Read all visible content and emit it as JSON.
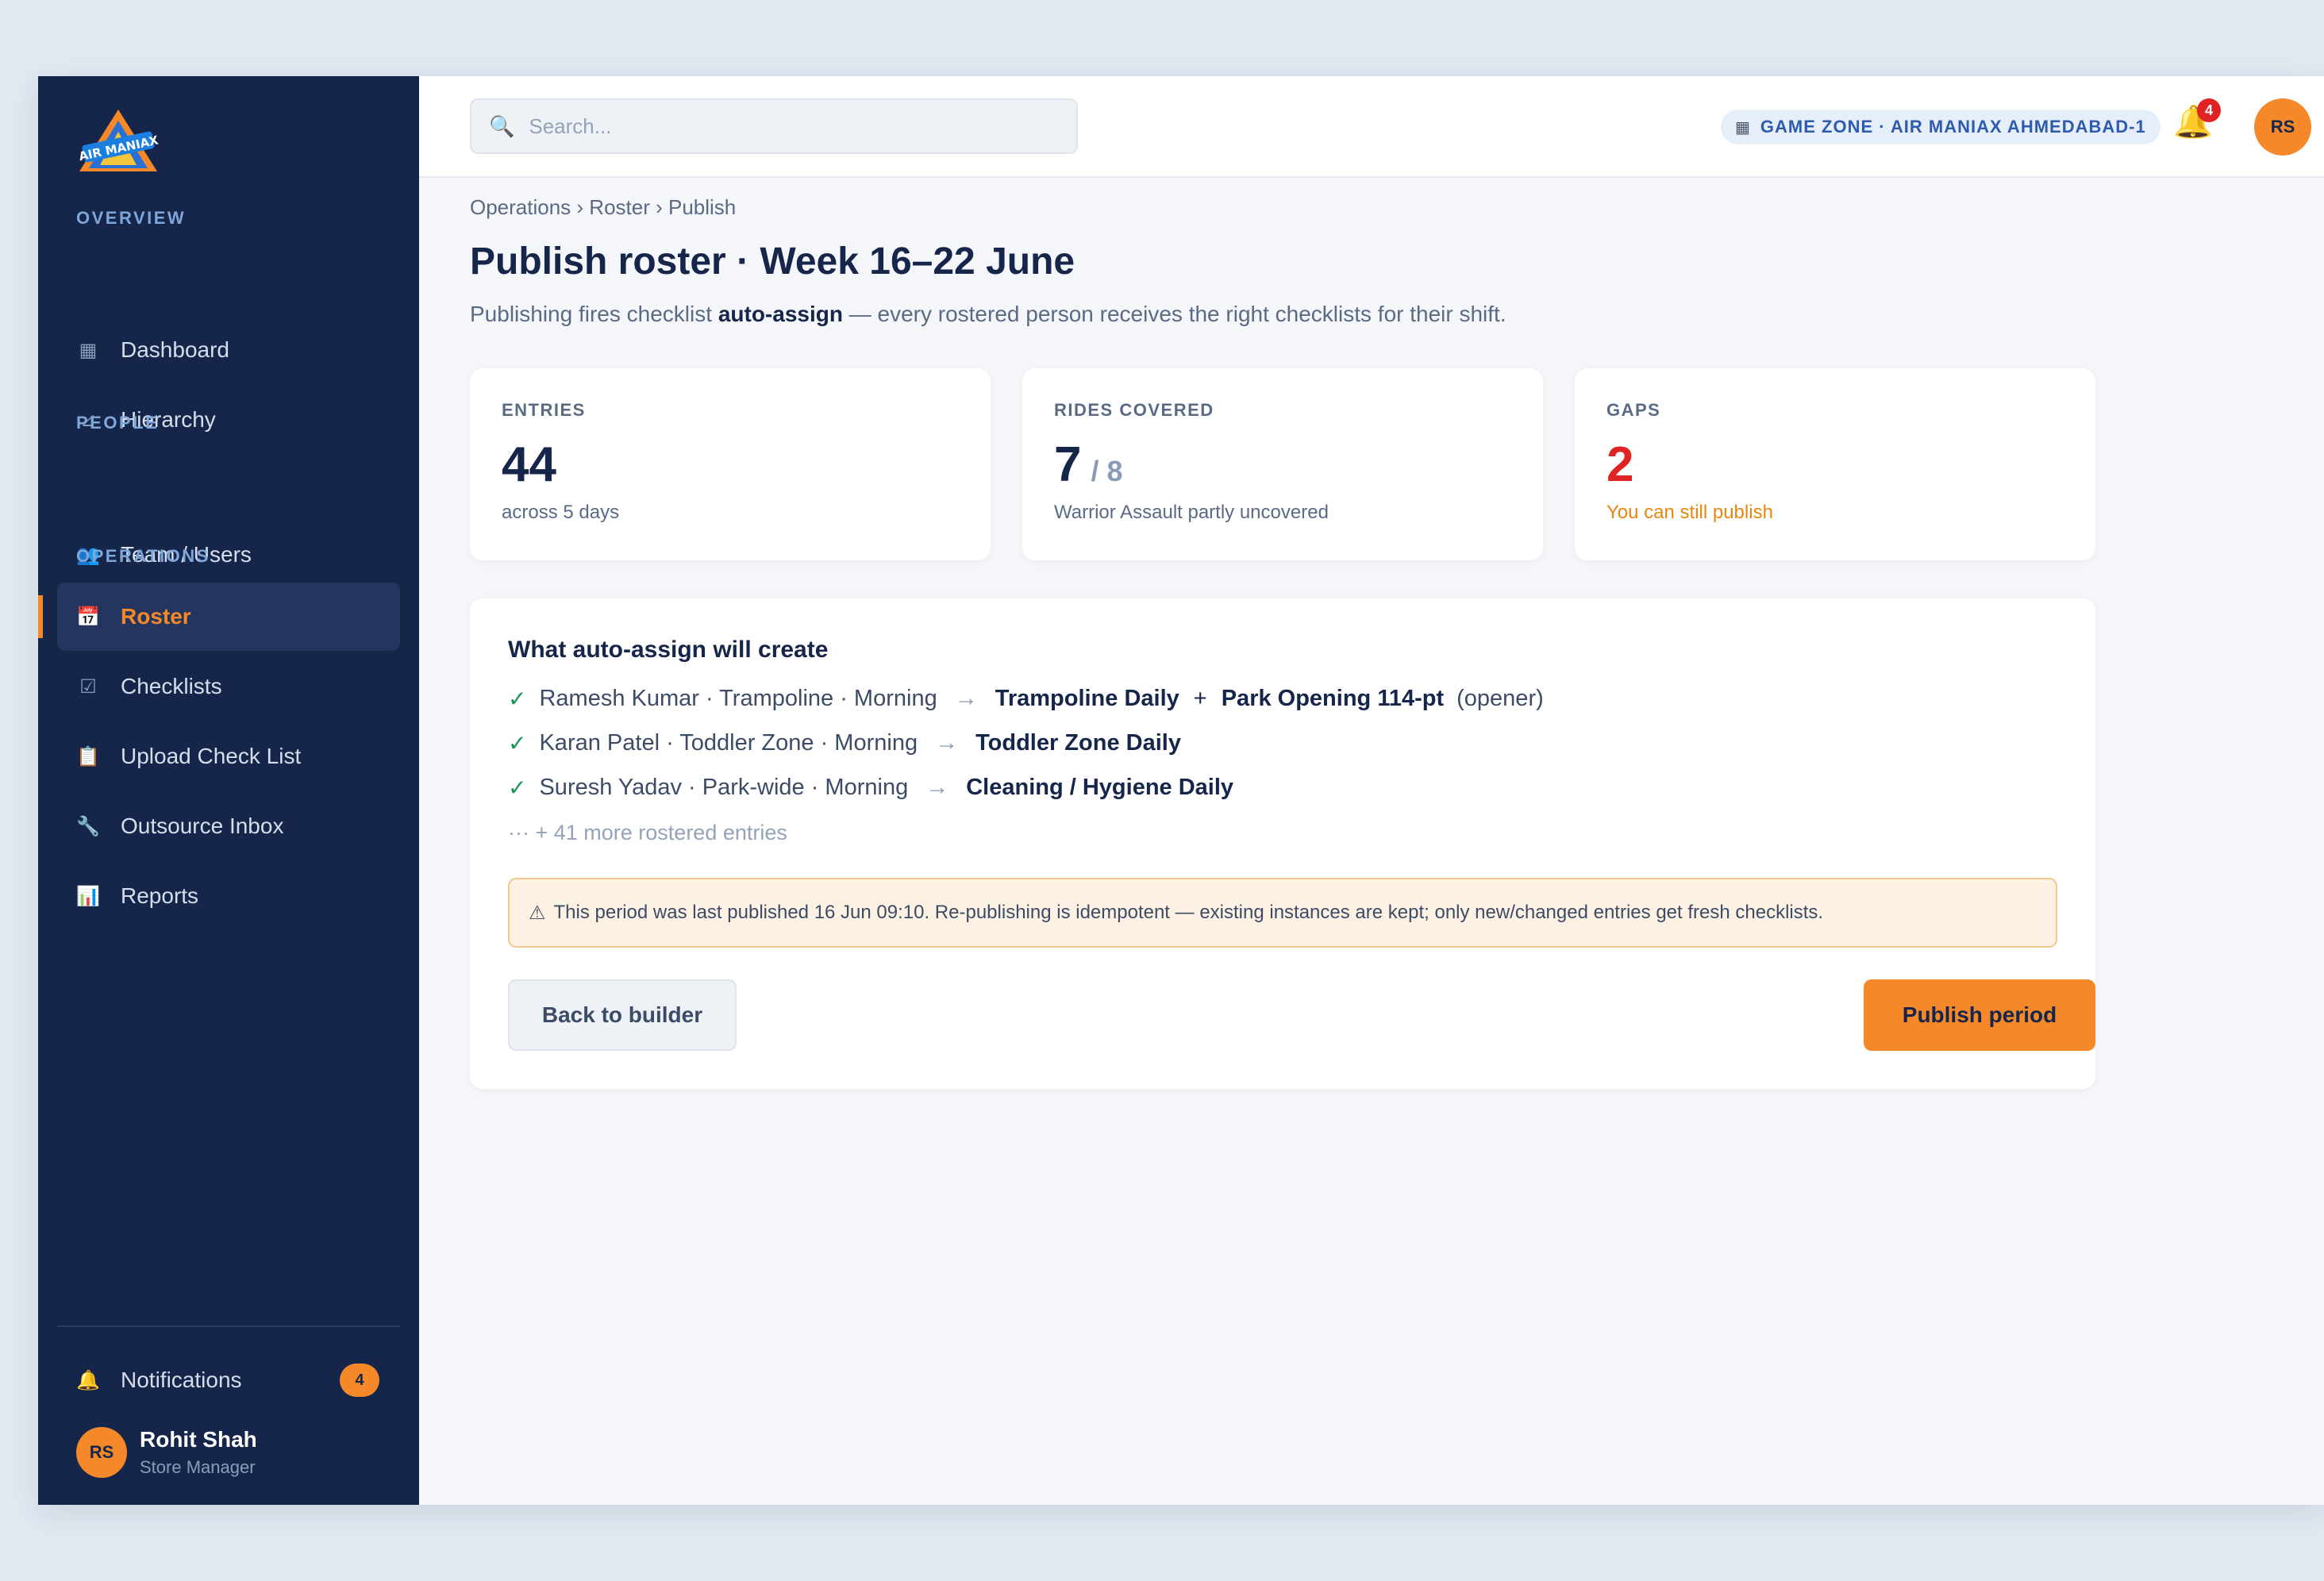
{
  "sidebar": {
    "sections": {
      "overview": "OVERVIEW",
      "people": "PEOPLE",
      "operations": "OPERATIONS"
    },
    "items": [
      {
        "label": "Dashboard",
        "icon": "grid-icon"
      },
      {
        "label": "Hierarchy",
        "icon": "hierarchy-icon"
      },
      {
        "label": "Team / Users",
        "icon": "users-icon"
      },
      {
        "label": "Roster",
        "icon": "calendar-icon"
      },
      {
        "label": "Checklists",
        "icon": "checkbox-icon"
      },
      {
        "label": "Upload Check List",
        "icon": "clipboard-icon"
      },
      {
        "label": "Outsource Inbox",
        "icon": "wrench-icon"
      },
      {
        "label": "Reports",
        "icon": "bar-chart-icon"
      }
    ],
    "notifications": {
      "label": "Notifications",
      "count": "4"
    },
    "user": {
      "initials": "RS",
      "name": "Rohit Shah",
      "role": "Store Manager"
    }
  },
  "topbar": {
    "search_placeholder": "Search...",
    "zone": "GAME ZONE · AIR MANIAX AHMEDABAD-1",
    "bell_count": "4",
    "avatar_initials": "RS"
  },
  "page": {
    "breadcrumb": "Operations › Roster › Publish",
    "title": "Publish roster · Week 16–22 June",
    "subtitle_pre": "Publishing fires checklist ",
    "subtitle_bold": "auto-assign",
    "subtitle_post": " — every rostered person receives the right checklists for their shift."
  },
  "stats": [
    {
      "label": "ENTRIES",
      "value": "44",
      "of": "",
      "note": "across 5 days"
    },
    {
      "label": "RIDES COVERED",
      "value": "7",
      "of": "/ 8",
      "note": "Warrior Assault partly uncovered"
    },
    {
      "label": "GAPS",
      "value": "2",
      "of": "",
      "note": "You can still publish"
    }
  ],
  "panel": {
    "title": "What auto-assign will create",
    "rows": [
      {
        "check": "✓",
        "who": "Ramesh Kumar · Trampoline · Morning",
        "arrow": "→",
        "checklist": "Trampoline Daily",
        "plus": "+",
        "extra": "Park Opening 114-pt",
        "note": "(opener)"
      },
      {
        "check": "✓",
        "who": "Karan Patel · Toddler Zone · Morning",
        "arrow": "→",
        "checklist": "Toddler Zone Daily"
      },
      {
        "check": "✓",
        "who": "Suresh Yadav · Park-wide · Morning",
        "arrow": "→",
        "checklist": "Cleaning / Hygiene Daily"
      }
    ],
    "more": "··· + 41 more rostered entries",
    "warning": "This period was last published 16 Jun 09:10. Re-publishing is idempotent — existing instances are kept; only new/changed entries get fresh checklists.",
    "back_button": "Back to builder",
    "publish_button": "Publish period"
  },
  "colors": {
    "sidebar_bg": "#16264b",
    "accent": "#f5892a",
    "danger": "#e02424",
    "success": "#14975a"
  }
}
